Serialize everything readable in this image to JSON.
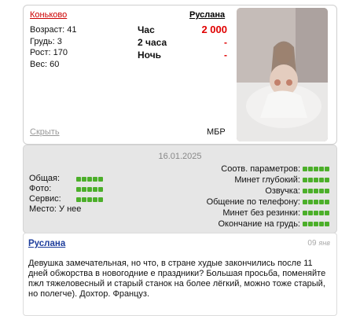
{
  "profile": {
    "district": "Коньково",
    "name": "Руслана",
    "params": [
      {
        "label": "Возраст:",
        "value": "41"
      },
      {
        "label": "Грудь:",
        "value": "3"
      },
      {
        "label": "Рост:",
        "value": "170"
      },
      {
        "label": "Вес:",
        "value": "60"
      }
    ],
    "prices": [
      {
        "label": "Час",
        "value": "2 000"
      },
      {
        "label": "2 часа",
        "value": "-"
      },
      {
        "label": "Ночь",
        "value": "-"
      }
    ],
    "hide_label": "Скрыть",
    "metro": "МБР",
    "price_color": "#e00000"
  },
  "review": {
    "date": "16.01.2025",
    "left_ratings": [
      {
        "label": "Общая:",
        "rating": 5
      },
      {
        "label": "Фото:",
        "rating": 5
      },
      {
        "label": "Сервис:",
        "rating": 5
      },
      {
        "label": "Место: У нее",
        "rating": 0
      }
    ],
    "right_ratings": [
      {
        "label": "Соотв. параметров:",
        "rating": 5
      },
      {
        "label": "Минет глубокий:",
        "rating": 5
      },
      {
        "label": "Озвучка:",
        "rating": 5
      },
      {
        "label": "Общение по телефону:",
        "rating": 5
      },
      {
        "label": "Минет без резинки:",
        "rating": 5
      },
      {
        "label": "Окончание на грудь:",
        "rating": 5
      }
    ],
    "rating_color": "#4caf2a"
  },
  "comment": {
    "author": "Руслана",
    "day": "09",
    "month": "янв",
    "text": "Девушка замечательная, но что, в стране худые закончились после 11 дней обжорства в новогодние е праздники? Большая просьба, поменяйте пжл тяжеловесный и старый станок на более лёгкий, можно тоже старый, но полегче). Дохтор. Француз."
  }
}
